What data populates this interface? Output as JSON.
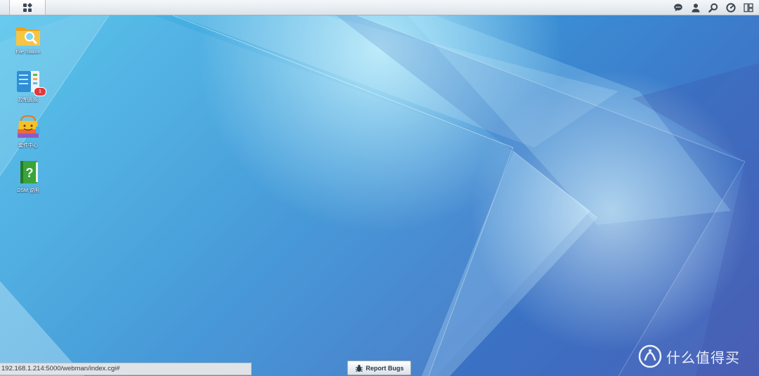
{
  "desktop": {
    "shortcuts": [
      {
        "label": "File Station",
        "icon": "file-station-icon"
      },
      {
        "label": "控制面板",
        "icon": "control-panel-icon",
        "badge": "1"
      },
      {
        "label": "套件中心",
        "icon": "package-center-icon"
      },
      {
        "label": "DSM 说明",
        "icon": "dsm-help-icon"
      }
    ]
  },
  "taskbar": {
    "main_menu_icon": "grid-menu-icon",
    "tray_icons": [
      "notification-chat-icon",
      "user-icon",
      "search-icon",
      "dashboard-gauge-icon",
      "widgets-icon"
    ]
  },
  "status_bar": {
    "url": "192.168.1.214:5000/webman/index.cgi#"
  },
  "report_bugs": {
    "label": "Report Bugs",
    "icon": "bug-icon"
  },
  "watermark": {
    "text": "什么值得买",
    "icon": "smzdm-logo-icon"
  },
  "colors": {
    "wallpaper_light": "#8fe3f7",
    "wallpaper_mid": "#3a93d6",
    "wallpaper_dark": "#4e63b8",
    "badge": "#e0383b"
  }
}
